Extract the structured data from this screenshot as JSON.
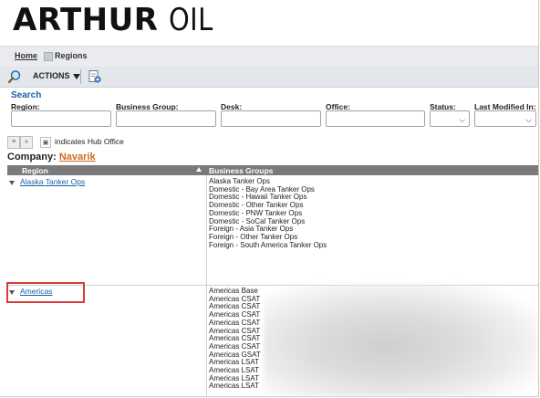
{
  "brand": {
    "logo_bold": "ARTHUR",
    "logo_light": "OIL"
  },
  "breadcrumb": {
    "home": "Home",
    "current": "Regions"
  },
  "toolbar": {
    "actions_label": "ACTIONS"
  },
  "search": {
    "title": "Search",
    "fields": {
      "region": {
        "label": "Region:",
        "value": ""
      },
      "business_group": {
        "label": "Business Group:",
        "value": ""
      },
      "desk": {
        "label": "Desk:",
        "value": ""
      },
      "office": {
        "label": "Office:",
        "value": ""
      },
      "status": {
        "label": "Status:",
        "value": ""
      },
      "last_modified": {
        "label": "Last Modified In:",
        "value": ""
      }
    }
  },
  "legend": {
    "hub_text": "indicates Hub Office"
  },
  "company": {
    "label": "Company:",
    "name": "Navarik"
  },
  "table": {
    "headers": {
      "region": "Region",
      "business_groups": "Business Groups"
    },
    "rows": [
      {
        "region": "Alaska Tanker Ops",
        "groups": [
          "Alaska Tanker Ops",
          "Domestic - Bay Area Tanker Ops",
          "Domestic - Hawaii Tanker Ops",
          "Domestic - Other Tanker Ops",
          "Domestic - PNW Tanker Ops",
          "Domestic - SoCal Tanker Ops",
          "Foreign - Asia Tanker Ops",
          "Foreign - Other Tanker Ops",
          "Foreign - South America Tanker Ops"
        ]
      },
      {
        "region": "Americas",
        "groups": [
          "Americas Base",
          "Americas CSAT",
          "Americas CSAT",
          "Americas CSAT",
          "Americas CSAT",
          "Americas CSAT",
          "Americas CSAT",
          "Americas CSAT",
          "Americas GSAT",
          "Americas LSAT",
          "Americas LSAT",
          "Americas LSAT",
          "Americas LSAT"
        ]
      }
    ]
  },
  "colors": {
    "link": "#1a5fa8",
    "company_link": "#d2691e",
    "header_bg": "#7a7a7a",
    "highlight": "#d93a3a"
  }
}
